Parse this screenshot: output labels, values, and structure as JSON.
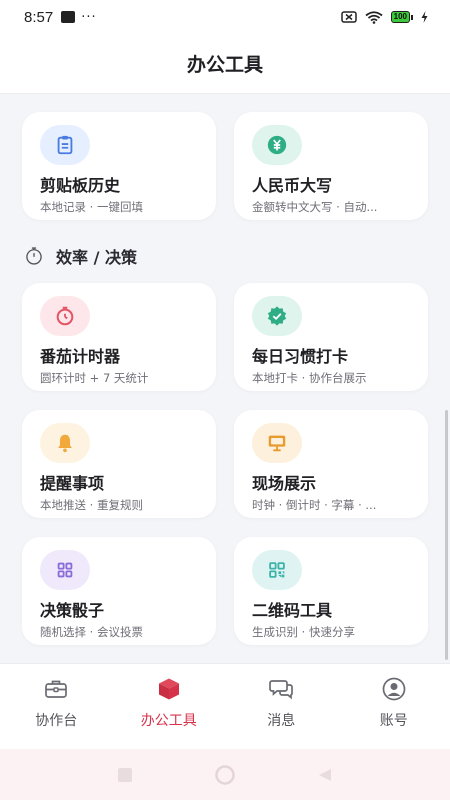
{
  "status": {
    "time": "8:57",
    "dots": "···",
    "battery": "100"
  },
  "header": {
    "title": "办公工具"
  },
  "top_cards": [
    {
      "title": "剪贴板历史",
      "sub": "本地记录 · 一键回填",
      "icon": "clipboard-icon",
      "bg": "#e6efff",
      "fg": "#4a7be0"
    },
    {
      "title": "人民币大写",
      "sub": "金额转中文大写 · 自动...",
      "icon": "yuan-icon",
      "bg": "#def4ec",
      "fg": "#2fae86"
    }
  ],
  "section": {
    "title": "效率 / 决策",
    "icon": "stopwatch-icon"
  },
  "cards": [
    {
      "title": "番茄计时器",
      "sub": "圆环计时 + 7 天统计",
      "icon": "timer-icon",
      "bg": "#fde7ea",
      "fg": "#e35466"
    },
    {
      "title": "每日习惯打卡",
      "sub": "本地打卡 · 协作台展示",
      "icon": "badge-check-icon",
      "bg": "#def4ec",
      "fg": "#2fae86"
    },
    {
      "title": "提醒事项",
      "sub": "本地推送 · 重复规则",
      "icon": "bell-icon",
      "bg": "#fdf3e0",
      "fg": "#f0a93a"
    },
    {
      "title": "现场展示",
      "sub": "时钟 · 倒计时 · 字幕 · ...",
      "icon": "monitor-icon",
      "bg": "#fdf0dc",
      "fg": "#e99a2c"
    },
    {
      "title": "决策骰子",
      "sub": "随机选择 · 会议投票",
      "icon": "grid-icon",
      "bg": "#efe9fb",
      "fg": "#8a6cd8"
    },
    {
      "title": "二维码工具",
      "sub": "生成识别 · 快速分享",
      "icon": "qrcode-icon",
      "bg": "#dff4f2",
      "fg": "#3cb3a8"
    }
  ],
  "tabs": [
    {
      "label": "协作台",
      "icon": "briefcase-icon",
      "active": false
    },
    {
      "label": "办公工具",
      "icon": "cube-icon",
      "active": true
    },
    {
      "label": "消息",
      "icon": "chat-icon",
      "active": false
    },
    {
      "label": "账号",
      "icon": "user-icon",
      "active": false
    }
  ],
  "colors": {
    "accent": "#d6334b",
    "background": "#f4f5f9"
  }
}
